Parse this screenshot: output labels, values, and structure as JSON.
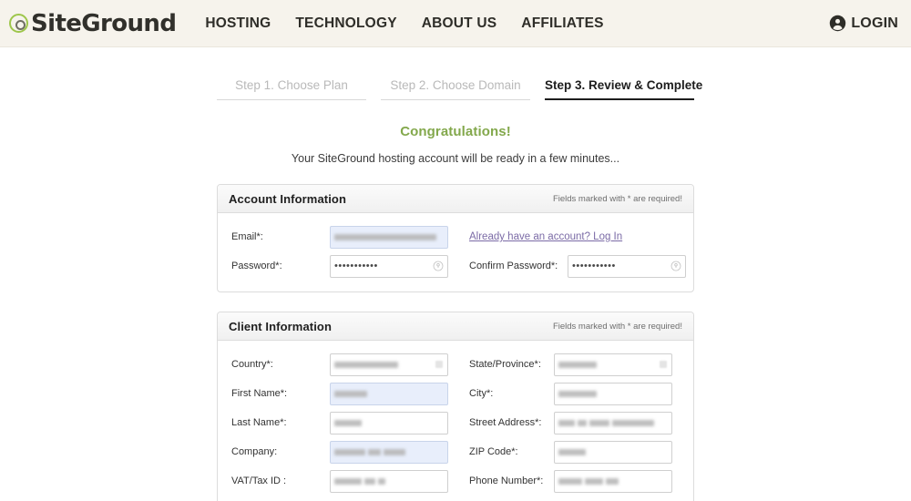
{
  "header": {
    "logo_text": "SiteGround",
    "logo_icon": "siteground-g-mark",
    "nav": [
      {
        "label": "HOSTING",
        "name": "nav-hosting"
      },
      {
        "label": "TECHNOLOGY",
        "name": "nav-technology"
      },
      {
        "label": "ABOUT US",
        "name": "nav-about-us"
      },
      {
        "label": "AFFILIATES",
        "name": "nav-affiliates"
      }
    ],
    "login_label": "LOGIN",
    "login_icon": "user-circle-icon",
    "background_color": "#f6f3ec"
  },
  "steps": [
    {
      "label": "Step 1. Choose Plan",
      "state": "inactive"
    },
    {
      "label": "Step 2. Choose Domain",
      "state": "inactive"
    },
    {
      "label": "Step 3. Review & Complete",
      "state": "active"
    }
  ],
  "congrats": {
    "title": "Congratulations!",
    "title_color": "#83a84c",
    "subtitle": "Your SiteGround hosting account will be ready in a few minutes..."
  },
  "account_panel": {
    "title": "Account Information",
    "note": "Fields marked with * are required!",
    "email_label": "Email*:",
    "email_value": "",
    "login_link": "Already have an account? Log In",
    "login_link_color": "#7b6ba6",
    "password_label": "Password*:",
    "password_value": "•••••••••••",
    "confirm_password_label": "Confirm Password*:",
    "confirm_password_value": "•••••••••••",
    "reveal_icon": "password-reveal-icon"
  },
  "client_panel": {
    "title": "Client Information",
    "note": "Fields marked with * are required!",
    "rows": [
      {
        "left": {
          "label": "Country*:",
          "value": "",
          "type": "select",
          "autofill": false
        },
        "right": {
          "label": "State/Province*:",
          "value": "",
          "type": "select",
          "autofill": false
        }
      },
      {
        "left": {
          "label": "First Name*:",
          "value": "",
          "type": "text",
          "autofill": true
        },
        "right": {
          "label": "City*:",
          "value": "",
          "type": "text",
          "autofill": false
        }
      },
      {
        "left": {
          "label": "Last Name*:",
          "value": "",
          "type": "text",
          "autofill": false
        },
        "right": {
          "label": "Street Address*:",
          "value": "",
          "type": "text",
          "autofill": false
        }
      },
      {
        "left": {
          "label": "Company:",
          "value": "",
          "type": "text",
          "autofill": true
        },
        "right": {
          "label": "ZIP Code*:",
          "value": "",
          "type": "text",
          "autofill": false
        }
      },
      {
        "left": {
          "label": "VAT/Tax ID :",
          "value": "",
          "type": "text",
          "autofill": false
        },
        "right": {
          "label": "Phone Number*:",
          "value": "",
          "type": "text",
          "autofill": false
        }
      }
    ]
  }
}
